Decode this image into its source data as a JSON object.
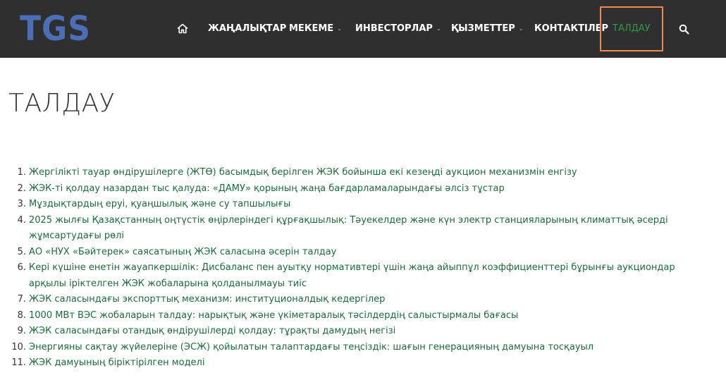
{
  "brand": {
    "logo_text": "TGS",
    "logo_color": "#4a6fb8"
  },
  "nav": {
    "home_icon": "home-icon",
    "items": [
      {
        "label": "ЖАҢАЛЫҚТАР",
        "has_dropdown": false
      },
      {
        "label": "МЕКЕМЕ",
        "has_dropdown": true
      },
      {
        "label": "ИНВЕСТОРЛАР",
        "has_dropdown": true
      },
      {
        "label": "ҚЫЗМЕТТЕР",
        "has_dropdown": true
      },
      {
        "label": "КОНТАКТІЛЕР",
        "has_dropdown": false
      },
      {
        "label": "ТАЛДАУ",
        "has_dropdown": false,
        "active": true
      }
    ],
    "search_icon": "search-icon",
    "active_color": "#2e9a4a",
    "highlight_color": "#f08a4b"
  },
  "page": {
    "title": "ТАЛДАУ"
  },
  "articles": [
    {
      "num": "1.",
      "title": "Жергілікті тауар өндірушілерге (ЖТӨ) басымдық берілген ЖЭК бойынша екі кезеңді аукцион механизмін енгізу"
    },
    {
      "num": "2.",
      "title": "ЖЭК-ті қолдау назардан тыс қалуда: «ДАМУ» қорының жаңа бағдарламаларындағы әлсіз тұстар"
    },
    {
      "num": "3.",
      "title": "Мұздықтардың еруі, қуаңшылық және су тапшылығы"
    },
    {
      "num": "4.",
      "title": "2025 жылғы Қазақстанның оңтүстік өңірлеріндегі құрғақшылық: Тәуекелдер және күн электр станцияларының климаттық әсерді жұмсартудағы рөлі"
    },
    {
      "num": "5.",
      "title": "АО «НУХ «Бәйтерек» саясатының ЖЭК саласына әсерін талдау"
    },
    {
      "num": "6.",
      "title": "Кері күшіне енетін жауапкершілік: Дисбаланс пен ауытқу нормативтері үшін жаңа айыппұл коэффициенттері бұрынғы аукциондар арқылы іріктелген ЖЭК жобаларына қолданылмауы тиіс"
    },
    {
      "num": "7.",
      "title": "ЖЭК саласындағы экспорттық механизм: институционалдық кедергілер"
    },
    {
      "num": "8.",
      "title": "1000 МВт ВЭС жобаларын талдау: нарықтық және үкіметаралық тәсілдердің салыстырмалы бағасы"
    },
    {
      "num": "9.",
      "title": "ЖЭК саласындағы отандық өндірушілерді қолдау: тұрақты дамудың негізі"
    },
    {
      "num": "10.",
      "title": "Энергияны сақтау жүйелеріне (ЭСЖ) қойылатын талаптардағы теңсіздік: шағын генерацияның дамуына тосқауыл"
    },
    {
      "num": "11.",
      "title": "ЖЭК дамуының біріктірілген моделі"
    }
  ]
}
